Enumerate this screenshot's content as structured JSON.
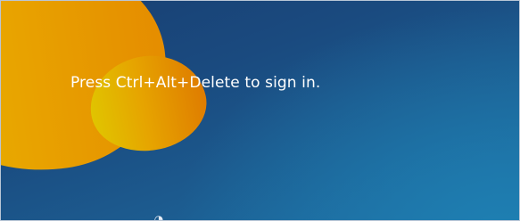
{
  "lock_screen": {
    "prompt": "Press Ctrl+Alt+Delete to sign in.",
    "icons": [
      "ease-of-access-icon"
    ]
  },
  "colors": {
    "background_top": "#183f72",
    "background_bottom": "#1d6ea3",
    "accent_orange": "#e8a300",
    "accent_yellow": "#e5c200",
    "text": "#ffffff"
  }
}
